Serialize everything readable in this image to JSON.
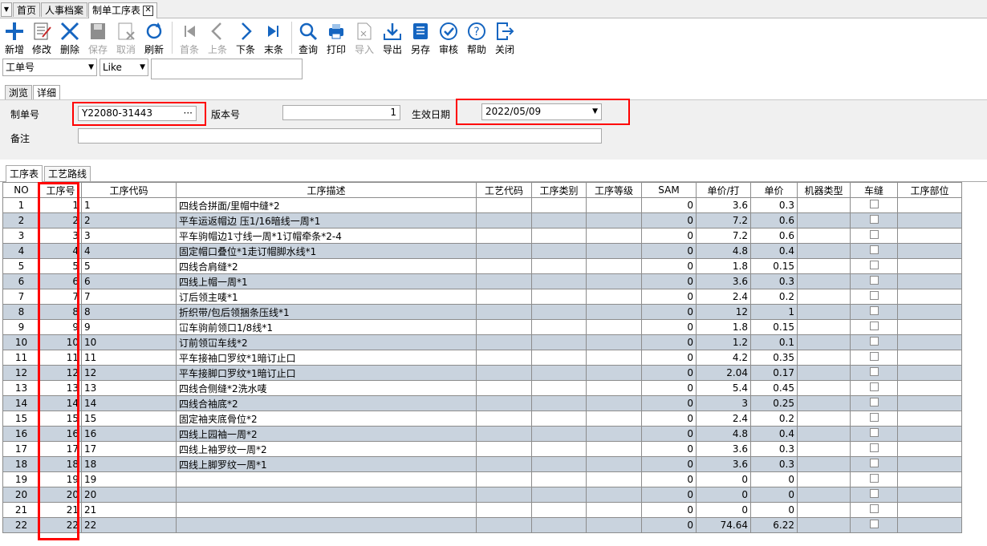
{
  "tabs": [
    {
      "label": "首页"
    },
    {
      "label": "人事档案"
    },
    {
      "label": "制单工序表",
      "close": "✕"
    }
  ],
  "toolbar": {
    "new": "新增",
    "edit": "修改",
    "delete": "删除",
    "save": "保存",
    "cancel": "取消",
    "refresh": "刷新",
    "first": "首条",
    "prev": "上条",
    "next": "下条",
    "last": "末条",
    "query": "查询",
    "print": "打印",
    "import": "导入",
    "export": "导出",
    "saveas": "另存",
    "audit": "审核",
    "help": "帮助",
    "close": "关闭"
  },
  "search": {
    "field": "工单号",
    "op": "Like",
    "value": ""
  },
  "view_tabs": {
    "browse": "浏览",
    "detail": "详细"
  },
  "form": {
    "order_label": "制单号",
    "order_value": "Y22080-31443",
    "order_btn": "···",
    "version_label": "版本号",
    "version_value": "1",
    "date_label": "生效日期",
    "date_value": "2022/05/09",
    "remark_label": "备注",
    "remark_value": ""
  },
  "grid_tabs": {
    "process": "工序表",
    "route": "工艺路线"
  },
  "columns": [
    "NO",
    "工序号",
    "工序代码",
    "工序描述",
    "工艺代码",
    "工序类别",
    "工序等级",
    "SAM",
    "单价/打",
    "单价",
    "机器类型",
    "车缝",
    "工序部位"
  ],
  "rows": [
    {
      "no": "1",
      "seq": "1",
      "code": "1",
      "desc": "四线合拼面/里帽中缝*2",
      "sam": "0",
      "dz": "3.6",
      "price": "0.3"
    },
    {
      "no": "2",
      "seq": "2",
      "code": "2",
      "desc": "平车运返帽边 压1/16暗线一周*1",
      "sam": "0",
      "dz": "7.2",
      "price": "0.6"
    },
    {
      "no": "3",
      "seq": "3",
      "code": "3",
      "desc": "平车驹帽边1寸线一周*1订帽牵条*2-4",
      "sam": "0",
      "dz": "7.2",
      "price": "0.6"
    },
    {
      "no": "4",
      "seq": "4",
      "code": "4",
      "desc": "固定帽口叠位*1走订帽脚水线*1",
      "sam": "0",
      "dz": "4.8",
      "price": "0.4"
    },
    {
      "no": "5",
      "seq": "5",
      "code": "5",
      "desc": "四线合肩缝*2",
      "sam": "0",
      "dz": "1.8",
      "price": "0.15"
    },
    {
      "no": "6",
      "seq": "6",
      "code": "6",
      "desc": "四线上帽一周*1",
      "sam": "0",
      "dz": "3.6",
      "price": "0.3"
    },
    {
      "no": "7",
      "seq": "7",
      "code": "7",
      "desc": "订后领主唛*1",
      "sam": "0",
      "dz": "2.4",
      "price": "0.2"
    },
    {
      "no": "8",
      "seq": "8",
      "code": "8",
      "desc": "折织带/包后领捆条压线*1",
      "sam": "0",
      "dz": "12",
      "price": "1"
    },
    {
      "no": "9",
      "seq": "9",
      "code": "9",
      "desc": "冚车驹前领口1/8线*1",
      "sam": "0",
      "dz": "1.8",
      "price": "0.15"
    },
    {
      "no": "10",
      "seq": "10",
      "code": "10",
      "desc": "订前领冚车线*2",
      "sam": "0",
      "dz": "1.2",
      "price": "0.1"
    },
    {
      "no": "11",
      "seq": "11",
      "code": "11",
      "desc": "平车接袖口罗纹*1暗订止口",
      "sam": "0",
      "dz": "4.2",
      "price": "0.35"
    },
    {
      "no": "12",
      "seq": "12",
      "code": "12",
      "desc": "平车接脚口罗纹*1暗订止口",
      "sam": "0",
      "dz": "2.04",
      "price": "0.17"
    },
    {
      "no": "13",
      "seq": "13",
      "code": "13",
      "desc": "四线合侧缝*2洗水唛",
      "sam": "0",
      "dz": "5.4",
      "price": "0.45"
    },
    {
      "no": "14",
      "seq": "14",
      "code": "14",
      "desc": "四线合袖底*2",
      "sam": "0",
      "dz": "3",
      "price": "0.25"
    },
    {
      "no": "15",
      "seq": "15",
      "code": "15",
      "desc": "固定袖夹底骨位*2",
      "sam": "0",
      "dz": "2.4",
      "price": "0.2"
    },
    {
      "no": "16",
      "seq": "16",
      "code": "16",
      "desc": "四线上园袖一周*2",
      "sam": "0",
      "dz": "4.8",
      "price": "0.4"
    },
    {
      "no": "17",
      "seq": "17",
      "code": "17",
      "desc": "四线上袖罗纹一周*2",
      "sam": "0",
      "dz": "3.6",
      "price": "0.3"
    },
    {
      "no": "18",
      "seq": "18",
      "code": "18",
      "desc": "四线上脚罗纹一周*1",
      "sam": "0",
      "dz": "3.6",
      "price": "0.3"
    },
    {
      "no": "19",
      "seq": "19",
      "code": "19",
      "desc": "",
      "sam": "0",
      "dz": "0",
      "price": "0"
    },
    {
      "no": "20",
      "seq": "20",
      "code": "20",
      "desc": "",
      "sam": "0",
      "dz": "0",
      "price": "0"
    },
    {
      "no": "21",
      "seq": "21",
      "code": "21",
      "desc": "",
      "sam": "0",
      "dz": "0",
      "price": "0"
    },
    {
      "no": "22",
      "seq": "22",
      "code": "22",
      "desc": "",
      "sam": "0",
      "dz": "74.64",
      "price": "6.22"
    }
  ],
  "colors": {
    "alt_row": "#c9d3de",
    "highlight": "#ff0000",
    "icon_blue": "#1565c0"
  }
}
